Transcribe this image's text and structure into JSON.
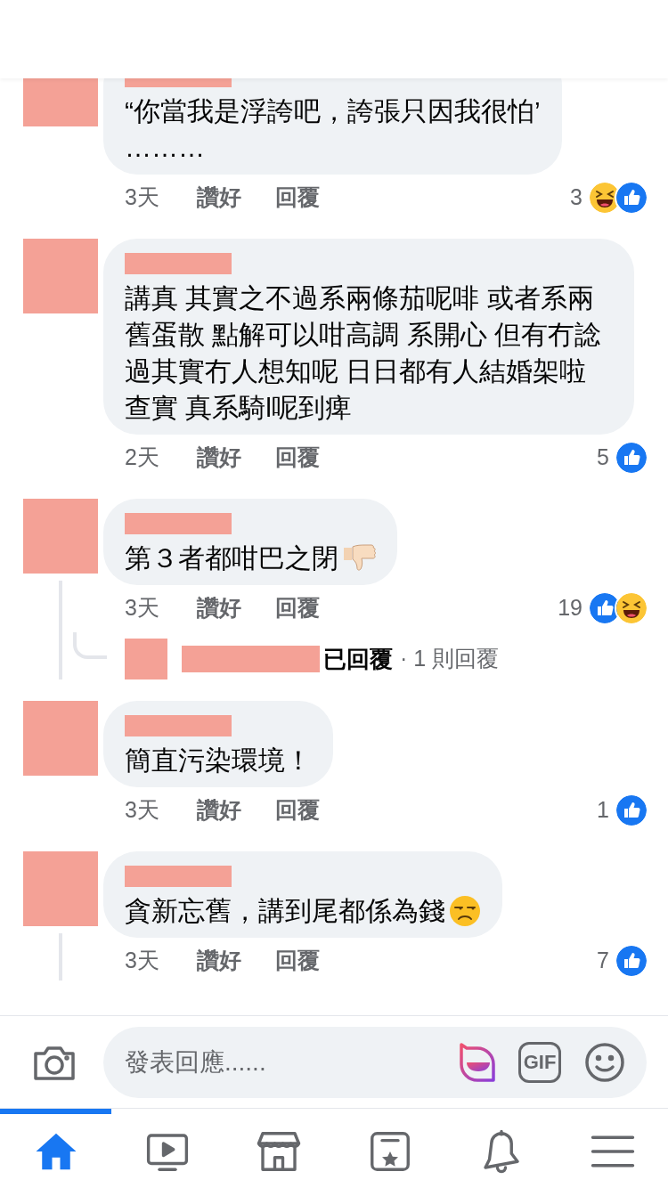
{
  "comments": [
    {
      "text": "“你當我是浮誇吧，誇張只因我很怕’\n………",
      "time": "3天",
      "like_label": "讚好",
      "reply_label": "回覆",
      "reaction_count": "3",
      "reactions": [
        {
          "kind": "haha"
        },
        {
          "kind": "like"
        }
      ],
      "thread_line": false
    },
    {
      "text": "講真 其實之不過系兩條茄呢啡 或者系兩舊蛋散 點解可以咁高調 系開心 但有冇諗過其實冇人想知呢 日日都有人結婚架啦查實 真系騎l呢到痺",
      "time": "2天",
      "like_label": "讚好",
      "reply_label": "回覆",
      "reaction_count": "5",
      "reactions": [
        {
          "kind": "like"
        }
      ],
      "thread_line": false
    },
    {
      "text": "第３者都咁巴之閉",
      "time": "3天",
      "like_label": "讚好",
      "reply_label": "回覆",
      "reaction_count": "19",
      "reactions": [
        {
          "kind": "like"
        },
        {
          "kind": "haha"
        }
      ],
      "emoji": {
        "kind": "thumbs_down"
      },
      "thread_line": true,
      "reply_summary": {
        "replied": "已回覆",
        "count": "· 1 則回覆"
      }
    },
    {
      "text": "簡直污染環境！",
      "time": "3天",
      "like_label": "讚好",
      "reply_label": "回覆",
      "reaction_count": "1",
      "reactions": [
        {
          "kind": "like"
        }
      ],
      "thread_line": false
    },
    {
      "text": "貪新忘舊，講到尾都係為錢",
      "time": "3天",
      "like_label": "讚好",
      "reply_label": "回覆",
      "reaction_count": "7",
      "reactions": [
        {
          "kind": "like"
        }
      ],
      "emoji": {
        "kind": "unamused"
      },
      "thread_line": true
    }
  ],
  "composer": {
    "placeholder": "發表回應......",
    "gif_label": "GIF"
  },
  "nav": [
    {
      "kind": "home",
      "selected": true
    },
    {
      "kind": "video",
      "selected": false
    },
    {
      "kind": "marketplace",
      "selected": false
    },
    {
      "kind": "saved",
      "selected": false
    },
    {
      "kind": "notifications",
      "selected": false
    },
    {
      "kind": "menu",
      "selected": false
    }
  ]
}
